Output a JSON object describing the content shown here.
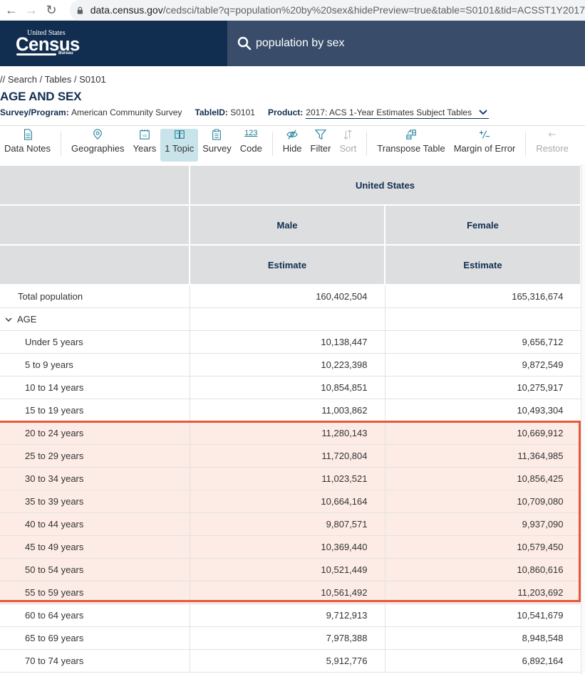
{
  "browser": {
    "url_host": "data.census.gov",
    "url_rest": "/cedsci/table?q=population%20by%20sex&hidePreview=true&table=S0101&tid=ACSST1Y2017"
  },
  "header": {
    "logo_top": "United States",
    "logo_main": "Census",
    "logo_bottom": "Bureau",
    "search_query": "population by sex",
    "brand_color": "#112e51",
    "search_bg": "#394d6a"
  },
  "breadcrumb": [
    "Search",
    "Tables",
    "S0101"
  ],
  "title": "AGE AND SEX",
  "meta": {
    "survey_label": "Survey/Program:",
    "survey_value": "American Community Survey",
    "tableid_label": "TableID:",
    "tableid_value": "S0101",
    "product_label": "Product:",
    "product_value": "2017: ACS 1-Year Estimates Subject Tables"
  },
  "toolbar": {
    "data_notes": "Data Notes",
    "geographies": "Geographies",
    "years": "Years",
    "topic": "1 Topic",
    "survey": "Survey",
    "code_glyph": "123",
    "code": "Code",
    "hide": "Hide",
    "filter": "Filter",
    "sort": "Sort",
    "transpose": "Transpose Table",
    "moe": "Margin of Error",
    "restore": "Restore"
  },
  "table": {
    "geo_header": "United States",
    "col_headers": [
      "Male",
      "Female"
    ],
    "sub_headers": [
      "Estimate",
      "Estimate"
    ],
    "total_row": {
      "label": "Total population",
      "male": "160,402,504",
      "female": "165,316,674"
    },
    "group_label": "AGE",
    "rows": [
      {
        "label": "Under 5 years",
        "male": "10,138,447",
        "female": "9,656,712",
        "highlight": false
      },
      {
        "label": "5 to 9 years",
        "male": "10,223,398",
        "female": "9,872,549",
        "highlight": false
      },
      {
        "label": "10 to 14 years",
        "male": "10,854,851",
        "female": "10,275,917",
        "highlight": false
      },
      {
        "label": "15 to 19 years",
        "male": "11,003,862",
        "female": "10,493,304",
        "highlight": false
      },
      {
        "label": "20 to 24 years",
        "male": "11,280,143",
        "female": "10,669,912",
        "highlight": true
      },
      {
        "label": "25 to 29 years",
        "male": "11,720,804",
        "female": "11,364,985",
        "highlight": true
      },
      {
        "label": "30 to 34 years",
        "male": "11,023,521",
        "female": "10,856,425",
        "highlight": true
      },
      {
        "label": "35 to 39 years",
        "male": "10,664,164",
        "female": "10,709,080",
        "highlight": true
      },
      {
        "label": "40 to 44 years",
        "male": "9,807,571",
        "female": "9,937,090",
        "highlight": true
      },
      {
        "label": "45 to 49 years",
        "male": "10,369,440",
        "female": "10,579,450",
        "highlight": true
      },
      {
        "label": "50 to 54 years",
        "male": "10,521,449",
        "female": "10,860,616",
        "highlight": true
      },
      {
        "label": "55 to 59 years",
        "male": "10,561,492",
        "female": "11,203,692",
        "highlight": true
      },
      {
        "label": "60 to 64 years",
        "male": "9,712,913",
        "female": "10,541,679",
        "highlight": false
      },
      {
        "label": "65 to 69 years",
        "male": "7,978,388",
        "female": "8,948,548",
        "highlight": false
      },
      {
        "label": "70 to 74 years",
        "male": "5,912,776",
        "female": "6,892,164",
        "highlight": false
      }
    ],
    "highlight_color": "#e4593b"
  }
}
